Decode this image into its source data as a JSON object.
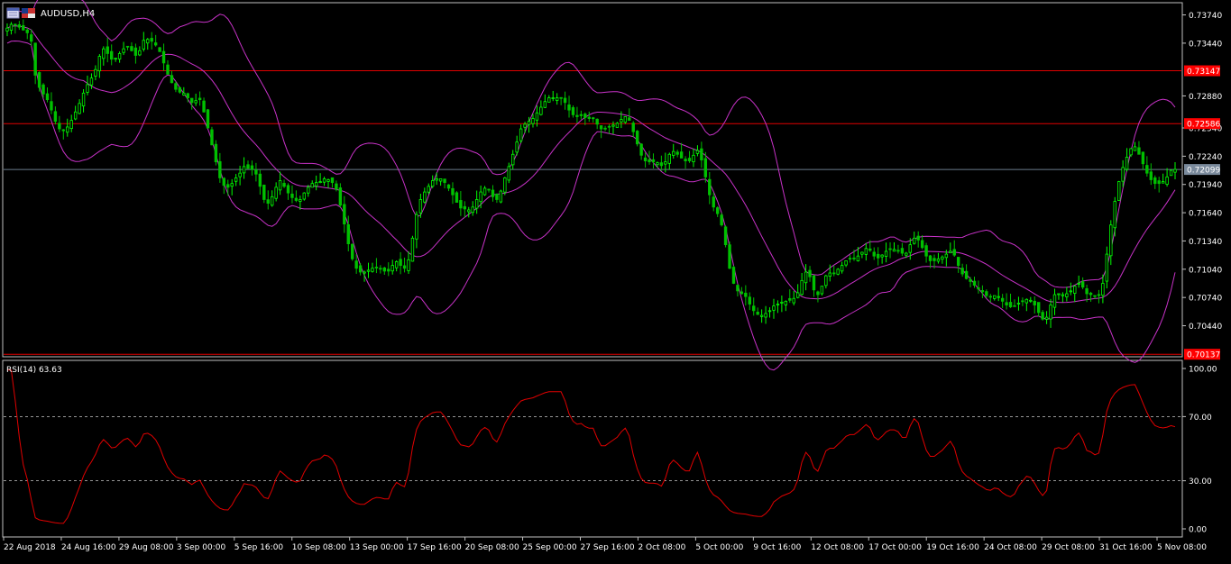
{
  "window": {
    "symbol_title": "AUDUSD,H4",
    "indicator_title": "RSI(14) 63.63"
  },
  "colors": {
    "background": "#000000",
    "frame": "#c0c0c0",
    "candle_up": "#00ff00",
    "candle_down": "#00c000",
    "bollinger": "#c832c8",
    "hline": "#e00000",
    "hline_label_bg": "#ff0000",
    "bid_line": "#6b7b8c",
    "bid_label_bg": "#7a8a9c",
    "rsi_line": "#e00000",
    "rsi_levels": "#c8c8c8"
  },
  "price_axis": {
    "ticks": [
      "0.73740",
      "0.73440",
      "0.72880",
      "0.72540",
      "0.72240",
      "0.71940",
      "0.71640",
      "0.71340",
      "0.71040",
      "0.70740",
      "0.70440"
    ]
  },
  "price_labels": {
    "upper_line": "0.73147",
    "middle_line": "0.72586",
    "bid": "0.72099",
    "lower_line": "0.70137"
  },
  "rsi_axis": {
    "ticks": [
      "100.00",
      "70.00",
      "30.00",
      "0.00"
    ]
  },
  "time_axis": {
    "ticks": [
      "22 Aug 2018",
      "24 Aug 16:00",
      "29 Aug 08:00",
      "3 Sep 00:00",
      "5 Sep 16:00",
      "10 Sep 08:00",
      "13 Sep 00:00",
      "17 Sep 16:00",
      "20 Sep 08:00",
      "25 Sep 00:00",
      "27 Sep 16:00",
      "2 Oct 08:00",
      "5 Oct 00:00",
      "9 Oct 16:00",
      "12 Oct 08:00",
      "17 Oct 00:00",
      "19 Oct 16:00",
      "24 Oct 08:00",
      "29 Oct 08:00",
      "31 Oct 16:00",
      "5 Nov 08:00"
    ]
  },
  "chart_data": {
    "type": "candlestick",
    "symbol": "AUDUSD",
    "timeframe": "H4",
    "price_range": [
      0.7012,
      0.7386
    ],
    "price_tick_values": [
      0.7374,
      0.7344,
      0.7288,
      0.7254,
      0.7224,
      0.7194,
      0.7164,
      0.7134,
      0.7104,
      0.7074,
      0.7044
    ],
    "horizontal_lines": [
      0.73147,
      0.72586,
      0.70137
    ],
    "bid": 0.72099,
    "time_ticks": [
      "22 Aug 2018",
      "24 Aug 16:00",
      "29 Aug 08:00",
      "3 Sep 00:00",
      "5 Sep 16:00",
      "10 Sep 08:00",
      "13 Sep 00:00",
      "17 Sep 16:00",
      "20 Sep 08:00",
      "25 Sep 00:00",
      "27 Sep 16:00",
      "2 Oct 08:00",
      "5 Oct 00:00",
      "9 Oct 16:00",
      "12 Oct 08:00",
      "17 Oct 00:00",
      "19 Oct 16:00",
      "24 Oct 08:00",
      "29 Oct 08:00",
      "31 Oct 16:00",
      "5 Nov 08:00"
    ],
    "close_series": [
      0.736,
      0.7364,
      0.7363,
      0.7361,
      0.7358,
      0.7355,
      0.7346,
      0.731,
      0.7297,
      0.729,
      0.7284,
      0.7273,
      0.7261,
      0.7253,
      0.7251,
      0.7255,
      0.7262,
      0.7271,
      0.728,
      0.7291,
      0.73,
      0.7307,
      0.7316,
      0.733,
      0.7338,
      0.7333,
      0.7327,
      0.7328,
      0.7333,
      0.7338,
      0.734,
      0.7336,
      0.7331,
      0.7336,
      0.7347,
      0.7348,
      0.7346,
      0.7342,
      0.7335,
      0.7323,
      0.7311,
      0.7302,
      0.7295,
      0.7292,
      0.7291,
      0.7286,
      0.7281,
      0.7283,
      0.7284,
      0.7271,
      0.7254,
      0.7236,
      0.7218,
      0.7201,
      0.7193,
      0.7191,
      0.7195,
      0.7201,
      0.7206,
      0.7213,
      0.7211,
      0.721,
      0.7205,
      0.7192,
      0.7178,
      0.7174,
      0.7181,
      0.7191,
      0.7198,
      0.7192,
      0.7185,
      0.718,
      0.7177,
      0.7178,
      0.7185,
      0.7191,
      0.7195,
      0.7196,
      0.7197,
      0.72,
      0.7199,
      0.7196,
      0.7189,
      0.7172,
      0.7152,
      0.7131,
      0.7115,
      0.7105,
      0.7101,
      0.7101,
      0.7103,
      0.7105,
      0.7106,
      0.7105,
      0.7102,
      0.7102,
      0.7108,
      0.7112,
      0.7108,
      0.7105,
      0.7114,
      0.7137,
      0.7162,
      0.7178,
      0.7186,
      0.7192,
      0.7198,
      0.72,
      0.72,
      0.7196,
      0.719,
      0.7183,
      0.7175,
      0.7169,
      0.7168,
      0.7167,
      0.717,
      0.7178,
      0.7186,
      0.719,
      0.7188,
      0.7181,
      0.7178,
      0.7187,
      0.7201,
      0.7213,
      0.7226,
      0.7239,
      0.7253,
      0.7258,
      0.7261,
      0.7264,
      0.727,
      0.7276,
      0.7282,
      0.7286,
      0.7286,
      0.7286,
      0.7286,
      0.7281,
      0.7273,
      0.7268,
      0.7266,
      0.7267,
      0.7265,
      0.7264,
      0.7264,
      0.7258,
      0.7253,
      0.7253,
      0.7255,
      0.7257,
      0.7259,
      0.7263,
      0.7266,
      0.7262,
      0.725,
      0.7237,
      0.7225,
      0.7219,
      0.7218,
      0.7218,
      0.7217,
      0.7214,
      0.7218,
      0.7226,
      0.7229,
      0.7226,
      0.7222,
      0.7219,
      0.7219,
      0.7225,
      0.723,
      0.722,
      0.7202,
      0.7183,
      0.717,
      0.7163,
      0.7151,
      0.713,
      0.7105,
      0.7089,
      0.7081,
      0.7078,
      0.7075,
      0.7067,
      0.706,
      0.7056,
      0.7055,
      0.7057,
      0.706,
      0.7065,
      0.7067,
      0.7069,
      0.707,
      0.7071,
      0.7073,
      0.7079,
      0.7092,
      0.7101,
      0.7096,
      0.7082,
      0.7077,
      0.7086,
      0.7097,
      0.71,
      0.71,
      0.7104,
      0.7108,
      0.7113,
      0.7115,
      0.7115,
      0.7118,
      0.7122,
      0.7126,
      0.7124,
      0.7118,
      0.7116,
      0.7119,
      0.7123,
      0.7125,
      0.7125,
      0.7124,
      0.7121,
      0.7121,
      0.713,
      0.7137,
      0.7135,
      0.7127,
      0.7118,
      0.7113,
      0.7113,
      0.7115,
      0.7117,
      0.712,
      0.7123,
      0.7119,
      0.7108,
      0.7099,
      0.7094,
      0.7091,
      0.7087,
      0.7083,
      0.708,
      0.7076,
      0.7075,
      0.7076,
      0.7075,
      0.707,
      0.7066,
      0.7064,
      0.7065,
      0.7068,
      0.707,
      0.7072,
      0.7071,
      0.7066,
      0.7058,
      0.7051,
      0.7053,
      0.7066,
      0.7077,
      0.7078,
      0.7077,
      0.7078,
      0.7081,
      0.7086,
      0.7089,
      0.7085,
      0.7078,
      0.7077,
      0.7075,
      0.7076,
      0.7089,
      0.712,
      0.7151,
      0.7176,
      0.7197,
      0.7212,
      0.7223,
      0.7232,
      0.7234,
      0.7226,
      0.7216,
      0.7206,
      0.7199,
      0.7195,
      0.7195,
      0.7197,
      0.7202,
      0.7209,
      0.721
    ],
    "rsi": {
      "period": 14,
      "last_value": 63.63,
      "levels": [
        70,
        30
      ],
      "range": [
        0,
        100
      ]
    },
    "overlays": [
      "Bollinger Bands"
    ]
  }
}
